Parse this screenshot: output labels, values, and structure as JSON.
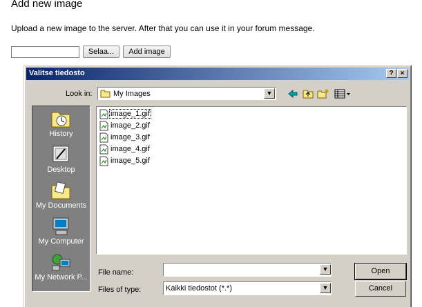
{
  "page": {
    "title": "Add new image",
    "description": "Upload a new image to the server. After that you can use it in your forum message.",
    "file_input_value": "",
    "browse_label": "Selaa...",
    "add_image_label": "Add image"
  },
  "dialog": {
    "title": "Valitse tiedosto",
    "help_label": "?",
    "close_label": "×",
    "look_in_label": "Look in:",
    "look_in_value": "My Images",
    "toolbar_icons": [
      "back-arrow-icon",
      "up-folder-icon",
      "new-folder-icon",
      "view-menu-icon"
    ],
    "places": [
      {
        "label": "History",
        "icon": "history-icon"
      },
      {
        "label": "Desktop",
        "icon": "desktop-icon"
      },
      {
        "label": "My Documents",
        "icon": "my-documents-icon"
      },
      {
        "label": "My Computer",
        "icon": "my-computer-icon"
      },
      {
        "label": "My Network P...",
        "icon": "my-network-icon"
      }
    ],
    "files": [
      "image_1.gif",
      "image_2.gif",
      "image_3.gif",
      "image_4.gif",
      "image_5.gif"
    ],
    "file_name_label": "File name:",
    "file_name_value": "",
    "file_type_label": "Files of type:",
    "file_type_value": "Kaikki tiedostot (*.*)",
    "open_label": "Open",
    "cancel_label": "Cancel"
  },
  "colors": {
    "dialog_face": "#d4d0c8",
    "title_gradient_start": "#0a246a",
    "title_gradient_end": "#a6caf0",
    "places_bar": "#808080"
  }
}
